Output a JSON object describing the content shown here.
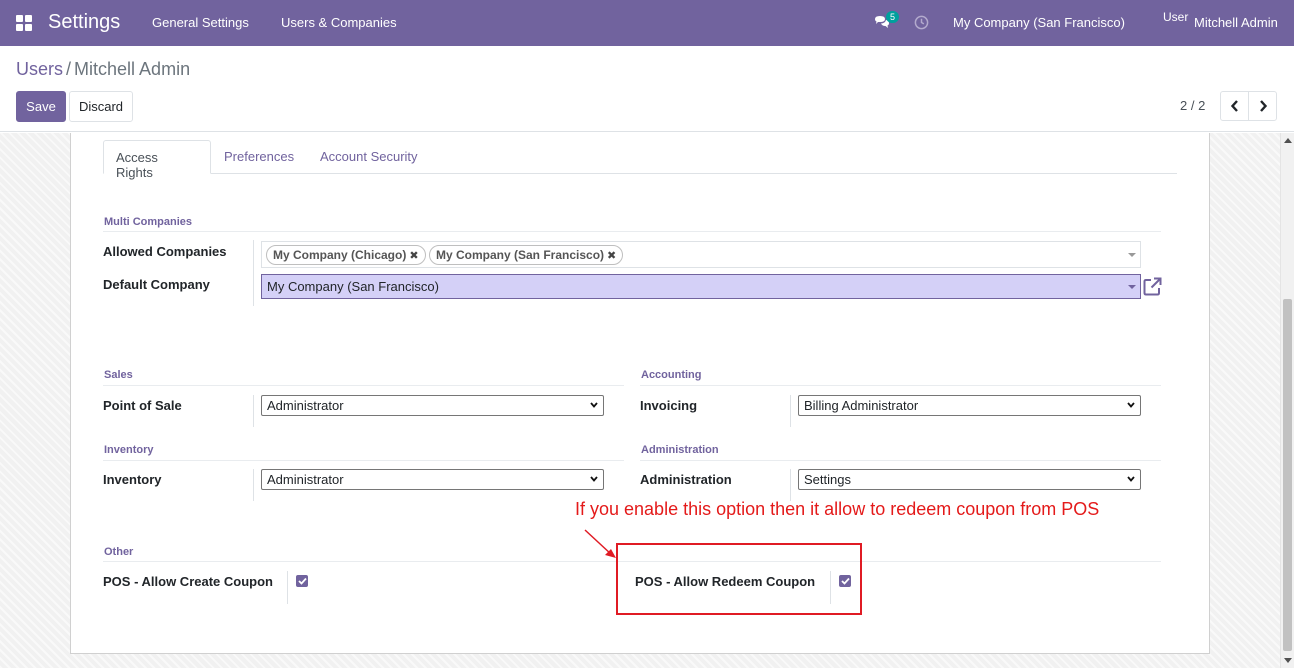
{
  "navbar": {
    "app_title": "Settings",
    "menu": [
      "General Settings",
      "Users & Companies"
    ],
    "chat_count": "5",
    "company": "My Company (San Francisco)",
    "avatar_alt": "User",
    "user": "Mitchell Admin",
    "colors": {
      "bar": "#71639e",
      "badge": "#00a09d"
    }
  },
  "breadcrumb": {
    "parent": "Users",
    "current": "Mitchell Admin"
  },
  "actions": {
    "save": "Save",
    "discard": "Discard"
  },
  "pager": {
    "value": "2 / 2"
  },
  "tabs": [
    {
      "label": "Access Rights",
      "active": true
    },
    {
      "label": "Preferences",
      "active": false
    },
    {
      "label": "Account Security",
      "active": false
    }
  ],
  "multi_companies": {
    "title": "Multi Companies",
    "allowed_label": "Allowed Companies",
    "allowed_tags": [
      "My Company (Chicago)",
      "My Company (San Francisco)"
    ],
    "default_label": "Default Company",
    "default_value": "My Company (San Francisco)"
  },
  "sales": {
    "title": "Sales",
    "field_label": "Point of Sale",
    "value": "Administrator"
  },
  "accounting": {
    "title": "Accounting",
    "field_label": "Invoicing",
    "value": "Billing Administrator"
  },
  "inventory": {
    "title": "Inventory",
    "field_label": "Inventory",
    "value": "Administrator"
  },
  "administration": {
    "title": "Administration",
    "field_label": "Administration",
    "value": "Settings"
  },
  "other": {
    "title": "Other",
    "create_coupon_label": "POS - Allow Create Coupon",
    "create_coupon_checked": true,
    "redeem_coupon_label": "POS - Allow Redeem Coupon",
    "redeem_coupon_checked": true
  },
  "annotation": {
    "text": "If you enable this option then it allow to redeem coupon from POS",
    "color": "#e41a1a"
  }
}
